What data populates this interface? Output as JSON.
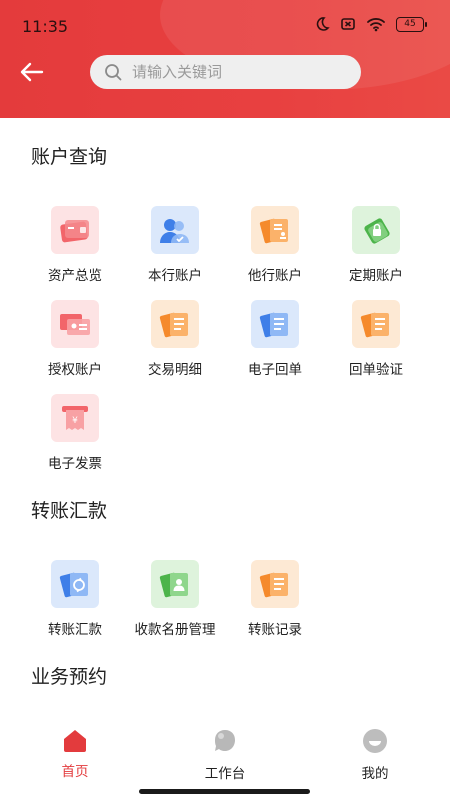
{
  "status_bar": {
    "time": "11:35",
    "battery": "45"
  },
  "search": {
    "placeholder": "请输入关键词"
  },
  "sections": [
    {
      "title": "账户查询",
      "items": [
        {
          "label": "资产总览",
          "icon": "wallet-icon",
          "color": "red"
        },
        {
          "label": "本行账户",
          "icon": "users-icon",
          "color": "blue"
        },
        {
          "label": "他行账户",
          "icon": "cards-icon",
          "color": "orange"
        },
        {
          "label": "定期账户",
          "icon": "lock-card-icon",
          "color": "green"
        },
        {
          "label": "授权账户",
          "icon": "id-card-icon",
          "color": "red"
        },
        {
          "label": "交易明细",
          "icon": "list-card-icon",
          "color": "orange"
        },
        {
          "label": "电子回单",
          "icon": "receipt-card-icon",
          "color": "blue"
        },
        {
          "label": "回单验证",
          "icon": "verify-card-icon",
          "color": "orange"
        },
        {
          "label": "电子发票",
          "icon": "invoice-icon",
          "color": "red"
        }
      ]
    },
    {
      "title": "转账汇款",
      "items": [
        {
          "label": "转账汇款",
          "icon": "transfer-icon",
          "color": "blue"
        },
        {
          "label": "收款名册管理",
          "icon": "payee-book-icon",
          "color": "green"
        },
        {
          "label": "转账记录",
          "icon": "record-icon",
          "color": "orange"
        }
      ]
    },
    {
      "title": "业务预约",
      "items": []
    }
  ],
  "tabbar": [
    {
      "label": "首页",
      "icon": "home-icon",
      "active": true
    },
    {
      "label": "工作台",
      "icon": "workbench-icon",
      "active": false
    },
    {
      "label": "我的",
      "icon": "profile-icon",
      "active": false
    }
  ],
  "colors": {
    "brand": "#e43b3c",
    "red": "#f06468",
    "blue": "#3f7fe8",
    "orange": "#f58a2c",
    "green": "#4cb44a"
  }
}
